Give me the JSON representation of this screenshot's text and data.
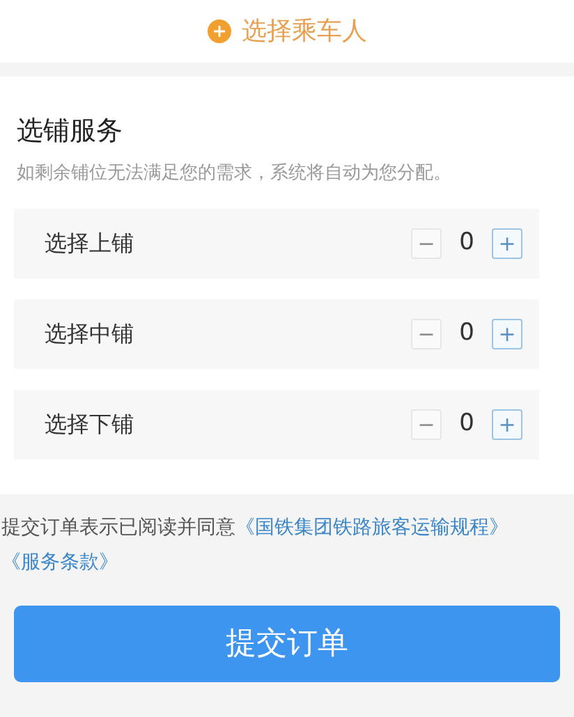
{
  "add_passenger": {
    "label": "选择乘车人"
  },
  "berth_service": {
    "title": "选铺服务",
    "hint": "如剩余铺位无法满足您的需求，系统将自动为您分配。",
    "rows": [
      {
        "label": "选择上铺",
        "count": "0",
        "minus": "−",
        "plus": "+",
        "minus_disabled": true
      },
      {
        "label": "选择中铺",
        "count": "0",
        "minus": "−",
        "plus": "+",
        "minus_disabled": true
      },
      {
        "label": "选择下铺",
        "count": "0",
        "minus": "−",
        "plus": "+",
        "minus_disabled": true
      }
    ]
  },
  "agreement": {
    "text": "提交订单表示已阅读并同意",
    "links": [
      "《国铁集团铁路旅客运输规程》",
      "《服务条款》"
    ]
  },
  "submit_button": {
    "label": "提交订单"
  }
}
